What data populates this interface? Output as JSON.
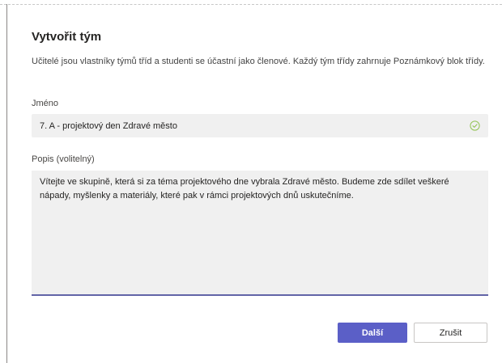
{
  "dialog": {
    "title": "Vytvořit tým",
    "description": "Učitelé jsou vlastníky týmů tříd a studenti se účastní jako členové. Každý tým třídy zahrnuje Poznámkový blok třídy.",
    "name_label": "Jméno",
    "name_value": "7. A - projektový den Zdravé město",
    "description_label": "Popis (volitelný)",
    "description_value": "Vítejte ve skupině, která si za téma projektového dne vybrala Zdravé město. Budeme zde sdílet veškeré nápady, myšlenky a materiály, které pak v rámci projektových dnů uskutečníme.",
    "next_button": "Další",
    "cancel_button": "Zrušit"
  },
  "colors": {
    "accent": "#5b5fc7",
    "field_background": "#f0f0f0",
    "valid_check": "#92c353"
  },
  "icons": {
    "name_status": "check-circle-icon"
  }
}
